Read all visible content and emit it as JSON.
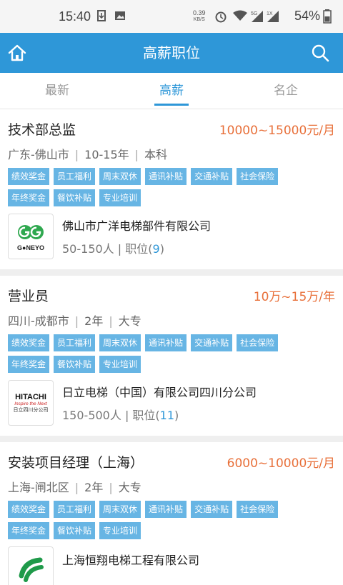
{
  "status": {
    "time": "15:40",
    "net_speed_top": "0.39",
    "net_speed_bottom": "KB/S",
    "battery": "54%"
  },
  "header": {
    "title": "高薪职位"
  },
  "tabs": [
    {
      "label": "最新",
      "active": false
    },
    {
      "label": "高薪",
      "active": true
    },
    {
      "label": "名企",
      "active": false
    }
  ],
  "jobs": [
    {
      "title": "技术部总监",
      "salary": "10000~15000元/月",
      "location": "广东-佛山市",
      "experience": "10-15年",
      "education": "本科",
      "tags": [
        "绩效奖金",
        "员工福利",
        "周末双休",
        "通讯补贴",
        "交通补贴",
        "社会保险",
        "年终奖金",
        "餐饮补贴",
        "专业培训"
      ],
      "company": "佛山市广洋电梯部件有限公司",
      "size": "50-150人",
      "positions_label": "职位(",
      "positions": "9",
      "positions_end": ")",
      "logo_text": "G●NEYO"
    },
    {
      "title": "营业员",
      "salary": "10万~15万/年",
      "location": "四川-成都市",
      "experience": "2年",
      "education": "大专",
      "tags": [
        "绩效奖金",
        "员工福利",
        "周末双休",
        "通讯补贴",
        "交通补贴",
        "社会保险",
        "年终奖金",
        "餐饮补贴",
        "专业培训"
      ],
      "company": "日立电梯（中国）有限公司四川分公司",
      "size": "150-500人",
      "positions_label": "职位(",
      "positions": "11",
      "positions_end": ")",
      "logo_text": "HITACHI",
      "logo_sub": "Inspire the Next",
      "logo_cn": "日立四川分公司"
    },
    {
      "title": "安装项目经理（上海）",
      "salary": "6000~10000元/月",
      "location": "上海-闸北区",
      "experience": "2年",
      "education": "大专",
      "tags": [
        "绩效奖金",
        "员工福利",
        "周末双休",
        "通讯补贴",
        "交通补贴",
        "社会保险",
        "年终奖金",
        "餐饮补贴",
        "专业培训"
      ],
      "company": "上海恒翔电梯工程有限公司"
    }
  ],
  "colors": {
    "accent": "#2e97d8",
    "salary": "#e8703a",
    "tag": "#67b5e4"
  }
}
